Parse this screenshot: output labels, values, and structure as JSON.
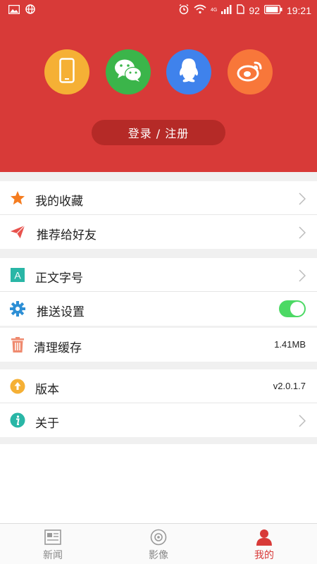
{
  "status_bar": {
    "battery": "92",
    "time": "19:21",
    "network": "4G"
  },
  "login": {
    "label": "登录 / 注册"
  },
  "social_icons": [
    "phone-icon",
    "wechat-icon",
    "qq-icon",
    "weibo-icon"
  ],
  "menu": {
    "favorites": "我的收藏",
    "recommend": "推荐给好友",
    "font_size": "正文字号",
    "push_settings": "推送设置",
    "push_enabled": true,
    "clear_cache": "清理缓存",
    "cache_size": "1.41MB",
    "version": "版本",
    "version_value": "v2.0.1.7",
    "about": "关于"
  },
  "nav": {
    "news": "新闻",
    "image": "影像",
    "mine": "我的",
    "active": "mine"
  },
  "colors": {
    "brand_red": "#d83a38",
    "toggle_on": "#4cd964"
  }
}
